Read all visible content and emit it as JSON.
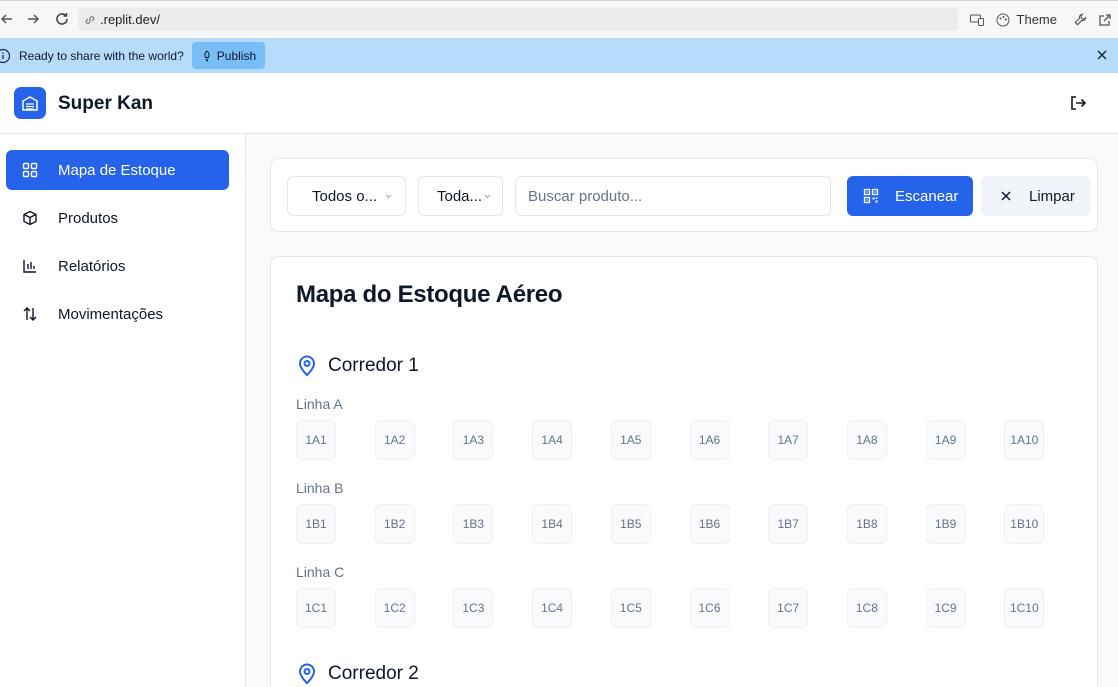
{
  "browser": {
    "url": ".replit.dev/",
    "theme_label": "Theme"
  },
  "banner": {
    "message": "Ready to share with the world?",
    "publish_label": "Publish"
  },
  "app": {
    "brand": "Super Kan"
  },
  "sidebar": {
    "items": [
      {
        "label": "Mapa de Estoque",
        "icon": "grid-icon",
        "active": true
      },
      {
        "label": "Produtos",
        "icon": "box-icon",
        "active": false
      },
      {
        "label": "Relatórios",
        "icon": "bar-chart-icon",
        "active": false
      },
      {
        "label": "Movimentações",
        "icon": "arrows-updown-icon",
        "active": false
      }
    ]
  },
  "filters": {
    "corridor_select": "Todos o...",
    "line_select": "Toda...",
    "search_placeholder": "Buscar produto...",
    "scan_label": "Escanear",
    "clear_label": "Limpar"
  },
  "map": {
    "title": "Mapa do Estoque Aéreo",
    "corridors": [
      {
        "name": "Corredor 1",
        "lines": [
          {
            "label": "Linha A",
            "slots": [
              "1A1",
              "1A2",
              "1A3",
              "1A4",
              "1A5",
              "1A6",
              "1A7",
              "1A8",
              "1A9",
              "1A10"
            ]
          },
          {
            "label": "Linha B",
            "slots": [
              "1B1",
              "1B2",
              "1B3",
              "1B4",
              "1B5",
              "1B6",
              "1B7",
              "1B8",
              "1B9",
              "1B10"
            ]
          },
          {
            "label": "Linha C",
            "slots": [
              "1C1",
              "1C2",
              "1C3",
              "1C4",
              "1C5",
              "1C6",
              "1C7",
              "1C8",
              "1C9",
              "1C10"
            ]
          }
        ]
      },
      {
        "name": "Corredor 2",
        "lines": []
      }
    ]
  },
  "colors": {
    "accent": "#2563eb",
    "banner": "#b7dcfb",
    "publish": "#79bdf6"
  }
}
